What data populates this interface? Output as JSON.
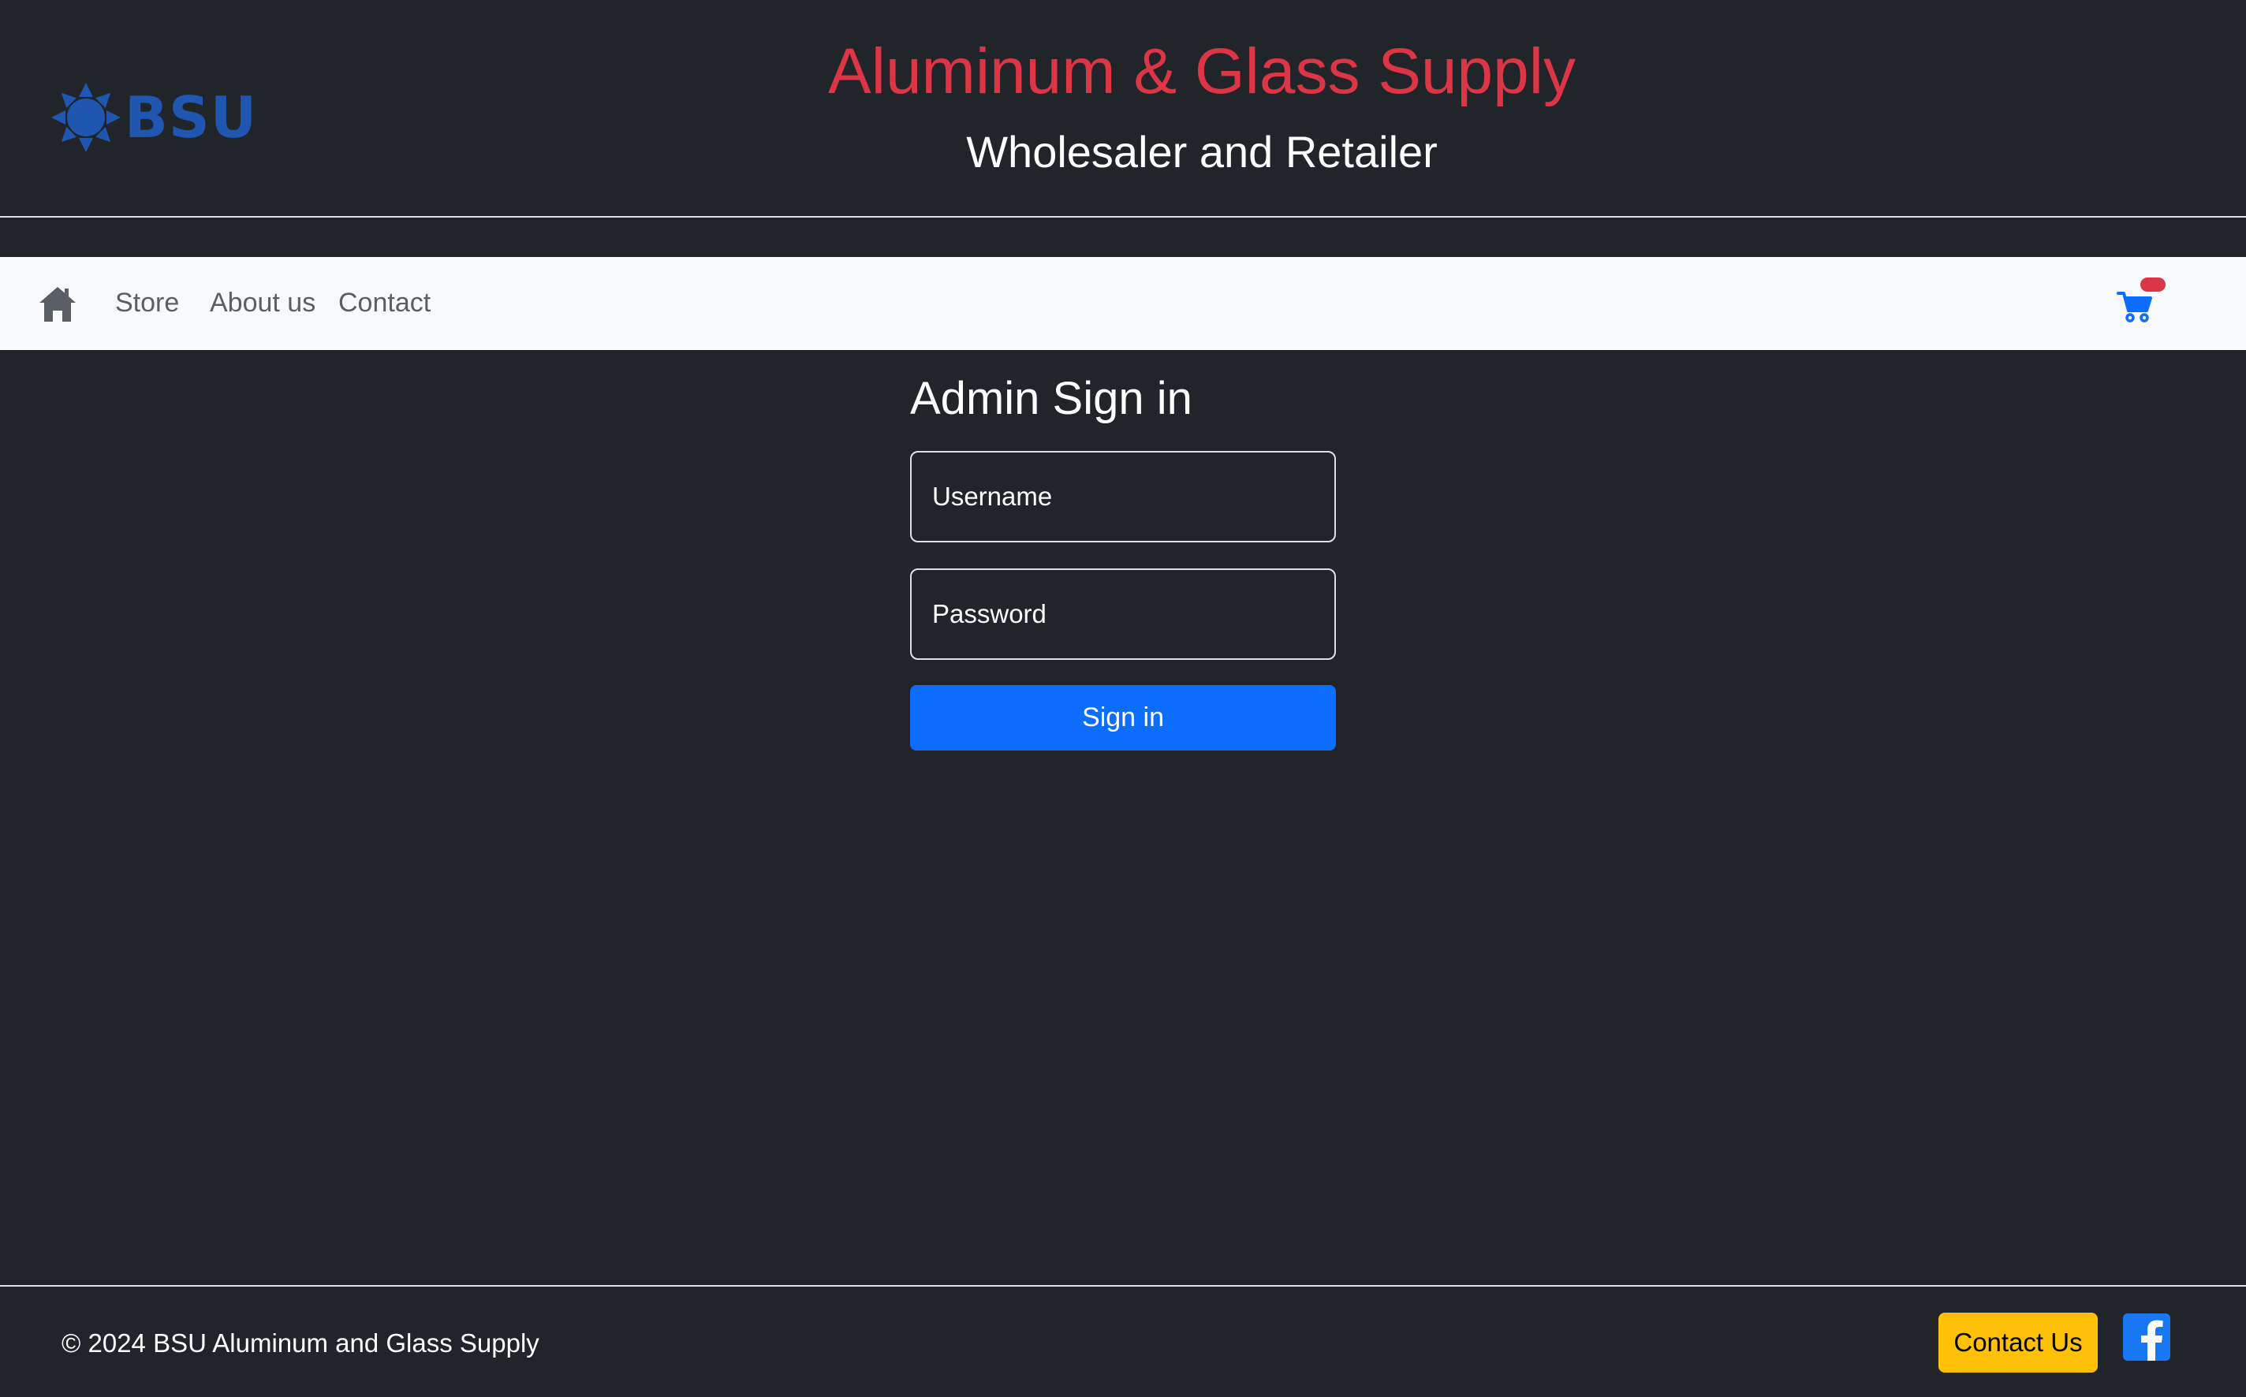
{
  "header": {
    "logo_text": "BSU",
    "title": "Aluminum & Glass Supply",
    "subtitle": "Wholesaler and Retailer"
  },
  "navbar": {
    "home_icon": "home-icon",
    "links": [
      {
        "label": "Store"
      },
      {
        "label": "About us"
      },
      {
        "label": "Contact"
      }
    ],
    "cart_icon": "cart-icon"
  },
  "signin": {
    "title": "Admin Sign in",
    "username_placeholder": "Username",
    "password_placeholder": "Password",
    "button_label": "Sign in"
  },
  "footer": {
    "copyright": "© 2024 BSU Aluminum and Glass Supply",
    "contact_label": "Contact Us",
    "facebook_icon": "facebook-icon"
  },
  "colors": {
    "background": "#212529",
    "title_red": "#dc3545",
    "primary_blue": "#0d6efd",
    "contact_yellow": "#ffc107",
    "navbar_bg": "#f8f9fa",
    "logo_blue": "#1e56b0"
  }
}
